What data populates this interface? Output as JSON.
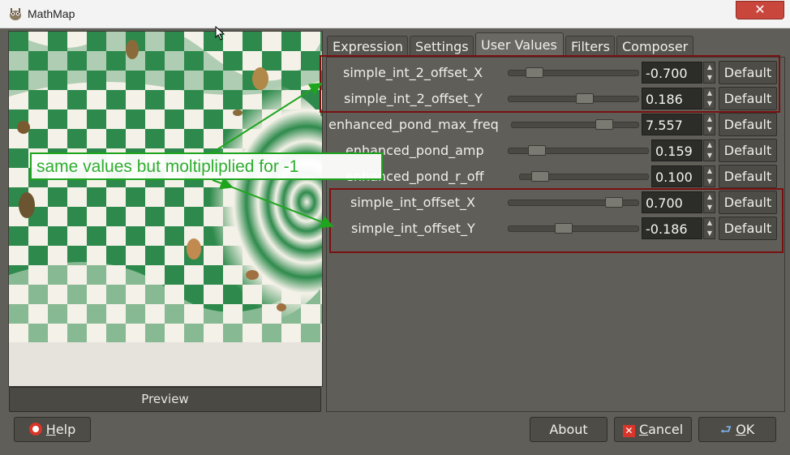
{
  "window": {
    "title": "MathMap",
    "close_glyph": "✕"
  },
  "tabs": [
    {
      "label": "Expression",
      "active": false
    },
    {
      "label": "Settings",
      "active": false
    },
    {
      "label": "User Values",
      "active": true
    },
    {
      "label": "Filters",
      "active": false
    },
    {
      "label": "Composer",
      "active": false
    }
  ],
  "preview": {
    "button_label": "Preview"
  },
  "annotation": {
    "text": "same values but moltipliplied for -1",
    "color": "#2fae2f"
  },
  "parameters": [
    {
      "label": "simple_int_2_offset_X",
      "value": "-0.700",
      "slider_fraction": 0.15
    },
    {
      "label": "simple_int_2_offset_Y",
      "value": "0.186",
      "slider_fraction": 0.59
    },
    {
      "label": "enhanced_pond_max_freq",
      "value": "7.557",
      "slider_fraction": 0.76
    },
    {
      "label": "enhanced_pond_amp",
      "value": "0.159",
      "slider_fraction": 0.16
    },
    {
      "label": "enhanced_pond_r_off",
      "value": "0.100",
      "slider_fraction": 0.1
    },
    {
      "label": "simple_int_offset_X",
      "value": "0.700",
      "slider_fraction": 0.85
    },
    {
      "label": "simple_int_offset_Y",
      "value": "-0.186",
      "slider_fraction": 0.41
    }
  ],
  "default_label": "Default",
  "buttons": {
    "help": {
      "label_underlined": "H",
      "label_rest": "elp"
    },
    "about": {
      "label": "About"
    },
    "cancel": {
      "label_underlined": "C",
      "label_rest": "ancel"
    },
    "ok": {
      "label_underlined": "O",
      "label_rest": "K"
    }
  },
  "colors": {
    "highlight": "#7a1010",
    "annotation_green": "#1ea51e",
    "panel_bg": "#5f5e58"
  }
}
